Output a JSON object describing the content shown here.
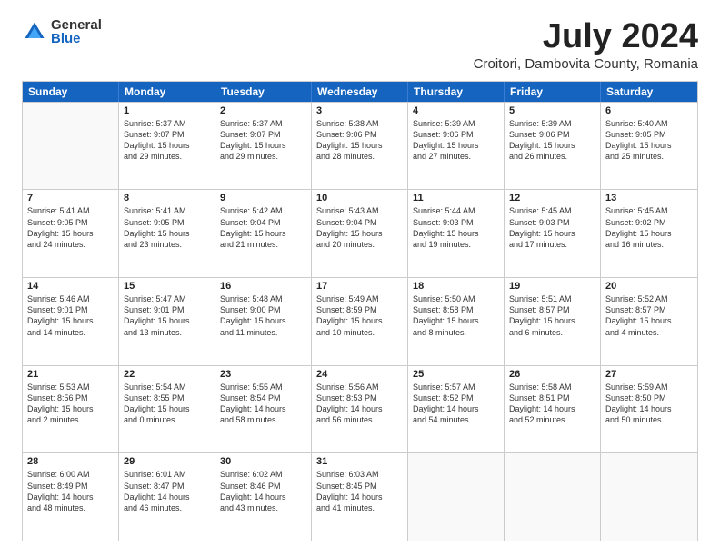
{
  "header": {
    "logo_general": "General",
    "logo_blue": "Blue",
    "title": "July 2024",
    "subtitle": "Croitori, Dambovita County, Romania"
  },
  "weekdays": [
    "Sunday",
    "Monday",
    "Tuesday",
    "Wednesday",
    "Thursday",
    "Friday",
    "Saturday"
  ],
  "rows": [
    [
      {
        "day": "",
        "info": ""
      },
      {
        "day": "1",
        "info": "Sunrise: 5:37 AM\nSunset: 9:07 PM\nDaylight: 15 hours\nand 29 minutes."
      },
      {
        "day": "2",
        "info": "Sunrise: 5:37 AM\nSunset: 9:07 PM\nDaylight: 15 hours\nand 29 minutes."
      },
      {
        "day": "3",
        "info": "Sunrise: 5:38 AM\nSunset: 9:06 PM\nDaylight: 15 hours\nand 28 minutes."
      },
      {
        "day": "4",
        "info": "Sunrise: 5:39 AM\nSunset: 9:06 PM\nDaylight: 15 hours\nand 27 minutes."
      },
      {
        "day": "5",
        "info": "Sunrise: 5:39 AM\nSunset: 9:06 PM\nDaylight: 15 hours\nand 26 minutes."
      },
      {
        "day": "6",
        "info": "Sunrise: 5:40 AM\nSunset: 9:05 PM\nDaylight: 15 hours\nand 25 minutes."
      }
    ],
    [
      {
        "day": "7",
        "info": "Sunrise: 5:41 AM\nSunset: 9:05 PM\nDaylight: 15 hours\nand 24 minutes."
      },
      {
        "day": "8",
        "info": "Sunrise: 5:41 AM\nSunset: 9:05 PM\nDaylight: 15 hours\nand 23 minutes."
      },
      {
        "day": "9",
        "info": "Sunrise: 5:42 AM\nSunset: 9:04 PM\nDaylight: 15 hours\nand 21 minutes."
      },
      {
        "day": "10",
        "info": "Sunrise: 5:43 AM\nSunset: 9:04 PM\nDaylight: 15 hours\nand 20 minutes."
      },
      {
        "day": "11",
        "info": "Sunrise: 5:44 AM\nSunset: 9:03 PM\nDaylight: 15 hours\nand 19 minutes."
      },
      {
        "day": "12",
        "info": "Sunrise: 5:45 AM\nSunset: 9:03 PM\nDaylight: 15 hours\nand 17 minutes."
      },
      {
        "day": "13",
        "info": "Sunrise: 5:45 AM\nSunset: 9:02 PM\nDaylight: 15 hours\nand 16 minutes."
      }
    ],
    [
      {
        "day": "14",
        "info": "Sunrise: 5:46 AM\nSunset: 9:01 PM\nDaylight: 15 hours\nand 14 minutes."
      },
      {
        "day": "15",
        "info": "Sunrise: 5:47 AM\nSunset: 9:01 PM\nDaylight: 15 hours\nand 13 minutes."
      },
      {
        "day": "16",
        "info": "Sunrise: 5:48 AM\nSunset: 9:00 PM\nDaylight: 15 hours\nand 11 minutes."
      },
      {
        "day": "17",
        "info": "Sunrise: 5:49 AM\nSunset: 8:59 PM\nDaylight: 15 hours\nand 10 minutes."
      },
      {
        "day": "18",
        "info": "Sunrise: 5:50 AM\nSunset: 8:58 PM\nDaylight: 15 hours\nand 8 minutes."
      },
      {
        "day": "19",
        "info": "Sunrise: 5:51 AM\nSunset: 8:57 PM\nDaylight: 15 hours\nand 6 minutes."
      },
      {
        "day": "20",
        "info": "Sunrise: 5:52 AM\nSunset: 8:57 PM\nDaylight: 15 hours\nand 4 minutes."
      }
    ],
    [
      {
        "day": "21",
        "info": "Sunrise: 5:53 AM\nSunset: 8:56 PM\nDaylight: 15 hours\nand 2 minutes."
      },
      {
        "day": "22",
        "info": "Sunrise: 5:54 AM\nSunset: 8:55 PM\nDaylight: 15 hours\nand 0 minutes."
      },
      {
        "day": "23",
        "info": "Sunrise: 5:55 AM\nSunset: 8:54 PM\nDaylight: 14 hours\nand 58 minutes."
      },
      {
        "day": "24",
        "info": "Sunrise: 5:56 AM\nSunset: 8:53 PM\nDaylight: 14 hours\nand 56 minutes."
      },
      {
        "day": "25",
        "info": "Sunrise: 5:57 AM\nSunset: 8:52 PM\nDaylight: 14 hours\nand 54 minutes."
      },
      {
        "day": "26",
        "info": "Sunrise: 5:58 AM\nSunset: 8:51 PM\nDaylight: 14 hours\nand 52 minutes."
      },
      {
        "day": "27",
        "info": "Sunrise: 5:59 AM\nSunset: 8:50 PM\nDaylight: 14 hours\nand 50 minutes."
      }
    ],
    [
      {
        "day": "28",
        "info": "Sunrise: 6:00 AM\nSunset: 8:49 PM\nDaylight: 14 hours\nand 48 minutes."
      },
      {
        "day": "29",
        "info": "Sunrise: 6:01 AM\nSunset: 8:47 PM\nDaylight: 14 hours\nand 46 minutes."
      },
      {
        "day": "30",
        "info": "Sunrise: 6:02 AM\nSunset: 8:46 PM\nDaylight: 14 hours\nand 43 minutes."
      },
      {
        "day": "31",
        "info": "Sunrise: 6:03 AM\nSunset: 8:45 PM\nDaylight: 14 hours\nand 41 minutes."
      },
      {
        "day": "",
        "info": ""
      },
      {
        "day": "",
        "info": ""
      },
      {
        "day": "",
        "info": ""
      }
    ]
  ]
}
